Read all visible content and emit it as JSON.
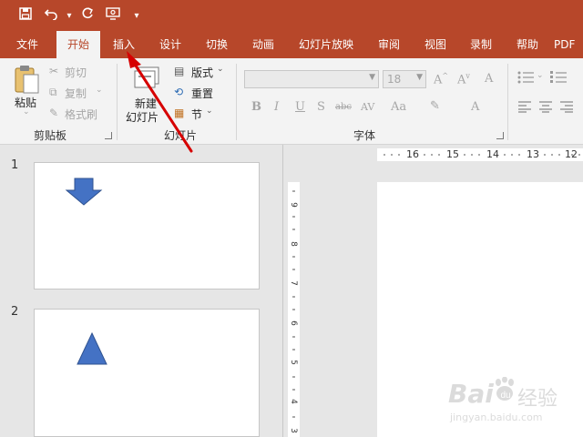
{
  "qat": {
    "icons": [
      "save-icon",
      "undo-icon",
      "redo-icon",
      "present-from-start-icon",
      "customize-qat-icon"
    ]
  },
  "tabs": [
    {
      "label": "文件"
    },
    {
      "label": "开始"
    },
    {
      "label": "插入"
    },
    {
      "label": "设计"
    },
    {
      "label": "切换"
    },
    {
      "label": "动画"
    },
    {
      "label": "幻灯片放映"
    },
    {
      "label": "审阅"
    },
    {
      "label": "视图"
    },
    {
      "label": "录制"
    },
    {
      "label": "帮助"
    },
    {
      "label": "PDF"
    }
  ],
  "active_tab": "开始",
  "ribbon": {
    "clipboard": {
      "paste": "粘贴",
      "cut": "剪切",
      "copy": "复制",
      "format_painter": "格式刷",
      "group_label": "剪贴板"
    },
    "slides": {
      "new_slide_line1": "新建",
      "new_slide_line2": "幻灯片",
      "layout": "版式",
      "reset": "重置",
      "section": "节",
      "group_label": "幻灯片"
    },
    "font": {
      "font_size": "18",
      "group_label": "字体",
      "buttons": [
        "B",
        "I",
        "U",
        "S",
        "abc",
        "AV",
        "Aa",
        "A"
      ]
    }
  },
  "slides": [
    {
      "number": "1",
      "shape": "down-arrow"
    },
    {
      "number": "2",
      "shape": "triangle"
    }
  ],
  "ruler": {
    "h_labels": [
      "16",
      "15",
      "14",
      "13",
      "12"
    ],
    "v_labels": [
      "9",
      "8",
      "7",
      "6",
      "5",
      "4",
      "3"
    ]
  },
  "watermark": {
    "brand": "Bai",
    "du": "du",
    "cn": "经验",
    "url": "jingyan.baidu.com"
  },
  "colors": {
    "accent": "#b7472a",
    "shape_fill": "#4472c4",
    "arrow": "#e00000"
  }
}
